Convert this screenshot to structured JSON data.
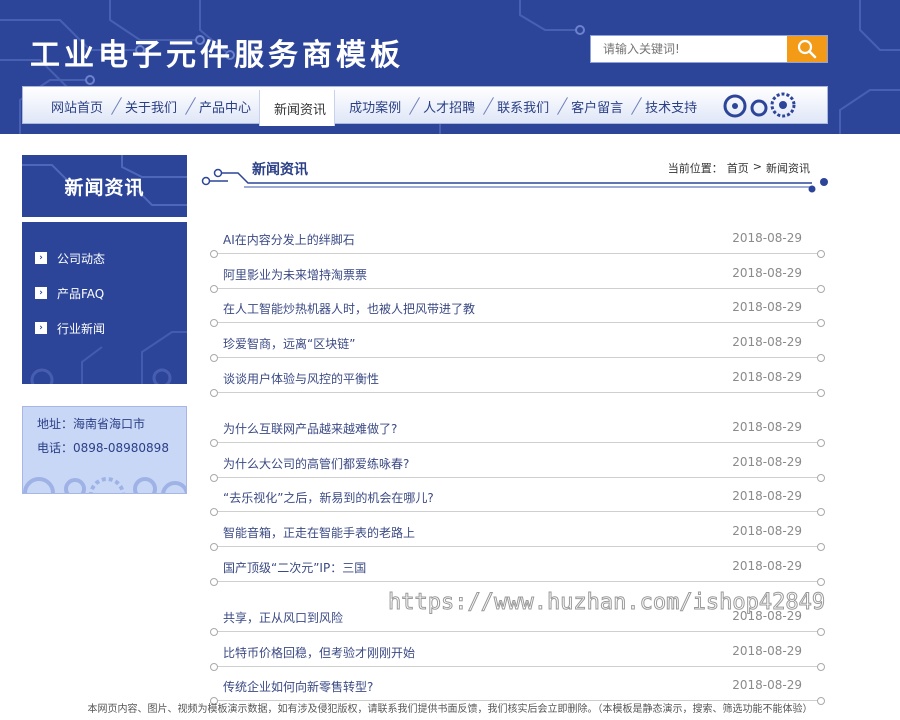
{
  "header": {
    "site_title": "工业电子元件服务商模板",
    "search_placeholder": "请输入关键词!"
  },
  "nav": [
    "网站首页",
    "关于我们",
    "产品中心",
    "新闻资讯",
    "成功案例",
    "人才招聘",
    "联系我们",
    "客户留言",
    "技术支持"
  ],
  "nav_active_index": 3,
  "sidebar": {
    "title": "新闻资讯",
    "items": [
      "公司动态",
      "产品FAQ",
      "行业新闻"
    ],
    "address": "地址：海南省海口市",
    "phone": "电话：0898-08980898"
  },
  "content": {
    "title": "新闻资讯",
    "breadcrumb_label": "当前位置：",
    "breadcrumb_home": "首页",
    "breadcrumb_sep": ">",
    "breadcrumb_current": "新闻资讯"
  },
  "news": [
    {
      "title": "AI在内容分发上的绊脚石",
      "date": "2018-08-29"
    },
    {
      "title": "阿里影业为未来增持淘票票",
      "date": "2018-08-29"
    },
    {
      "title": "在人工智能炒热机器人时，也被人把风带进了教",
      "date": "2018-08-29"
    },
    {
      "title": "珍爱智商，远离“区块链”",
      "date": "2018-08-29"
    },
    {
      "title": "谈谈用户体验与风控的平衡性",
      "date": "2018-08-29"
    },
    {
      "title": "为什么互联网产品越来越难做了?",
      "date": "2018-08-29"
    },
    {
      "title": "为什么大公司的高管们都爱练咏春?",
      "date": "2018-08-29"
    },
    {
      "title": "“去乐视化”之后，新易到的机会在哪儿?",
      "date": "2018-08-29"
    },
    {
      "title": "智能音箱，正走在智能手表的老路上",
      "date": "2018-08-29"
    },
    {
      "title": "国产顶级“二次元”IP：三国",
      "date": "2018-08-29"
    },
    {
      "title": "共享，正从风口到风险",
      "date": "2018-08-29"
    },
    {
      "title": "比特币价格回稳，但考验才刚刚开始",
      "date": "2018-08-29"
    },
    {
      "title": "传统企业如何向新零售转型?",
      "date": "2018-08-29"
    }
  ],
  "watermark": "https://www.huzhan.com/ishop42849",
  "footer": "本网页内容、图片、视频为模板演示数据，如有涉及侵犯版权，请联系我们提供书面反馈，我们核实后会立即删除。（本模板是静态演示，搜索、筛选功能不能体验）",
  "colors": {
    "primary": "#2c4599",
    "search_button": "#f39a16",
    "link": "#3b4a84",
    "date": "#8a8a8a"
  }
}
